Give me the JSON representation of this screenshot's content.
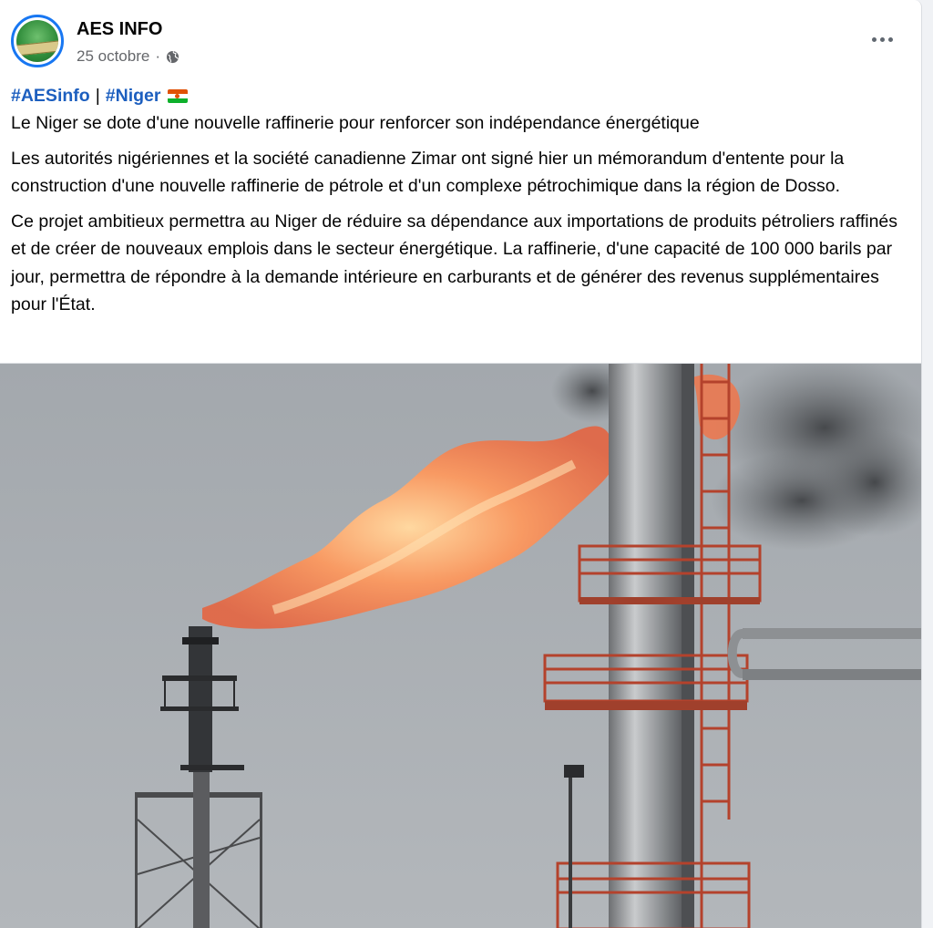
{
  "post": {
    "author": "AES INFO",
    "date": "25 octobre",
    "dot": "·",
    "visibility_icon": "globe-icon",
    "more_icon": "more-options-icon",
    "hashtags": [
      "#AESinfo",
      "#Niger"
    ],
    "hashtag_separator": "|",
    "flag": "niger-flag-emoji",
    "title": "Le Niger se dote d'une nouvelle raffinerie pour renforcer son indépendance énergétique",
    "paragraphs": [
      "Les autorités nigériennes et la société canadienne Zimar ont signé hier un mémorandum d'entente pour la construction d'une nouvelle raffinerie de pétrole et d'un complexe pétrochimique dans la région de Dosso.",
      "Ce projet ambitieux permettra au Niger de réduire sa dépendance aux importations de produits pétroliers raffinés et de créer de nouveaux emplois dans le secteur énergétique. La raffinerie, d'une capacité de 100 000 barils par jour, permettra de répondre à la demande intérieure en carburants et de générer des revenus supplémentaires pour l'État."
    ],
    "image": "refinery-flare-photo"
  },
  "colors": {
    "hashtag": "#1d5fbf",
    "meta_text": "#65676b",
    "avatar_ring": "#1877f2",
    "sky": "#a9aeb3",
    "flame": "#f0764a"
  }
}
